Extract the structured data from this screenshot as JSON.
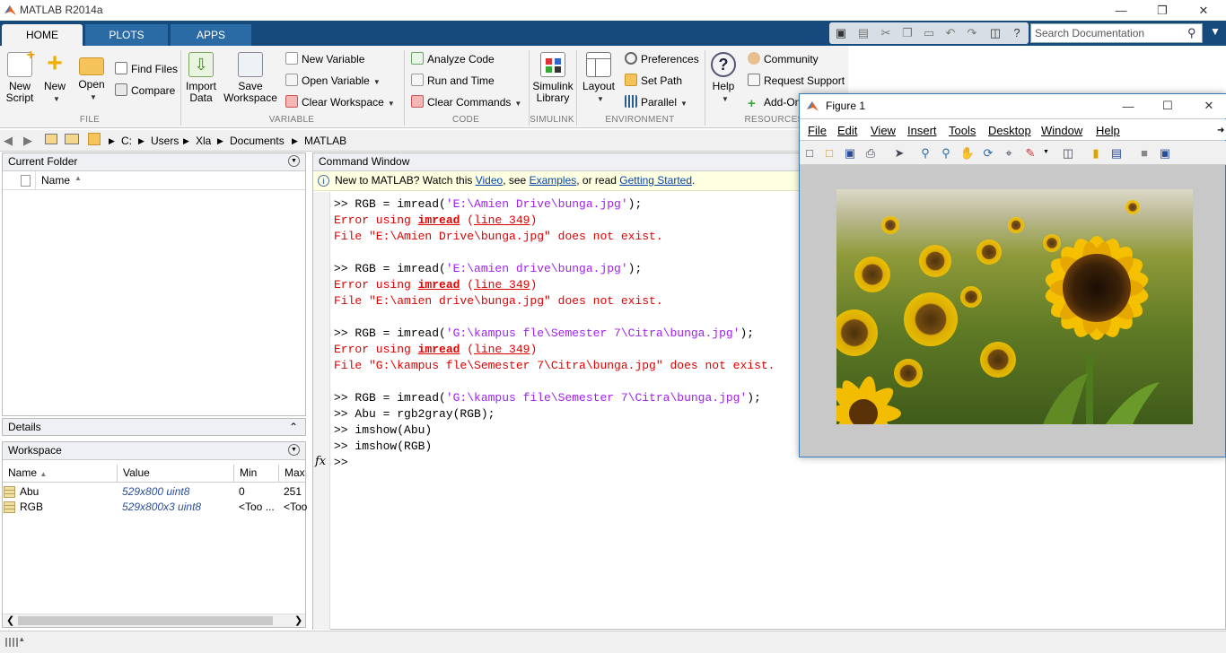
{
  "app": {
    "title": "MATLAB R2014a"
  },
  "tabs": [
    {
      "label": "HOME"
    },
    {
      "label": "PLOTS"
    },
    {
      "label": "APPS"
    }
  ],
  "search": {
    "placeholder": "Search Documentation"
  },
  "ribbon": {
    "file": {
      "group": "FILE",
      "new_script": "New\nScript",
      "new": "New",
      "open": "Open",
      "find_files": "Find Files",
      "compare": "Compare"
    },
    "variable": {
      "group": "VARIABLE",
      "import_data": "Import\nData",
      "save_workspace": "Save\nWorkspace",
      "new_variable": "New Variable",
      "open_variable": "Open Variable",
      "clear_workspace": "Clear Workspace"
    },
    "code": {
      "group": "CODE",
      "analyze_code": "Analyze Code",
      "run_and_time": "Run and Time",
      "clear_commands": "Clear Commands"
    },
    "simulink": {
      "group": "SIMULINK",
      "library": "Simulink\nLibrary"
    },
    "environment": {
      "group": "ENVIRONMENT",
      "layout": "Layout",
      "preferences": "Preferences",
      "set_path": "Set Path",
      "parallel": "Parallel"
    },
    "resources": {
      "group": "RESOURCES",
      "help": "Help",
      "community": "Community",
      "request_support": "Request Support",
      "add_ons": "Add-Ons"
    }
  },
  "path": [
    "C:",
    "Users",
    "Xla",
    "Documents",
    "MATLAB"
  ],
  "current_folder": {
    "title": "Current Folder",
    "col_name": "Name"
  },
  "details": {
    "title": "Details"
  },
  "workspace": {
    "title": "Workspace",
    "columns": [
      "Name",
      "Value",
      "Min",
      "Max"
    ],
    "rows": [
      {
        "name": "Abu",
        "value": "529x800 uint8",
        "min": "0",
        "max": "251"
      },
      {
        "name": "RGB",
        "value": "529x800x3 uint8",
        "min": "<Too ...",
        "max": "<Too"
      }
    ]
  },
  "command_window": {
    "title": "Command Window",
    "info": {
      "prefix": "New to MATLAB? Watch this ",
      "video": "Video",
      "mid": ", see ",
      "examples": "Examples",
      "mid2": ", or read ",
      "getting_started": "Getting Started",
      "suffix": "."
    },
    "lines": {
      "c1_pre": ">> RGB = imread(",
      "c1_str": "'E:\\Amien Drive\\bunga.jpg'",
      "c1_post": ");",
      "e1_a": "Error using ",
      "e1_fn": "imread",
      "e1_b": " (",
      "e1_ln": "line 349",
      "e1_c": ")",
      "e1_msg": "File \"E:\\Amien Drive\\bunga.jpg\" does not exist.",
      "c2_pre": ">> RGB = imread(",
      "c2_str": "'E:\\amien drive\\bunga.jpg'",
      "c2_post": ");",
      "e2_msg": "File \"E:\\amien drive\\bunga.jpg\" does not exist.",
      "c3_pre": ">> RGB = imread(",
      "c3_str": "'G:\\kampus fle\\Semester 7\\Citra\\bunga.jpg'",
      "c3_post": ");",
      "e3_msg": "File \"G:\\kampus fle\\Semester 7\\Citra\\bunga.jpg\" does not exist.",
      "c4_pre": ">> RGB = imread(",
      "c4_str": "'G:\\kampus file\\Semester 7\\Citra\\bunga.jpg'",
      "c4_post": ");",
      "c5": ">> Abu = rgb2gray(RGB);",
      "c6": ">> imshow(Abu)",
      "c7": ">> imshow(RGB)",
      "prompt": ">>",
      "fx": "fx"
    }
  },
  "figure": {
    "title": "Figure 1",
    "menu": [
      "File",
      "Edit",
      "View",
      "Insert",
      "Tools",
      "Desktop",
      "Window",
      "Help"
    ]
  },
  "colors": {
    "ribbon_bar": "#174a7c",
    "error": "#e00000",
    "string": "#a020f0",
    "link": "#0645ad"
  }
}
